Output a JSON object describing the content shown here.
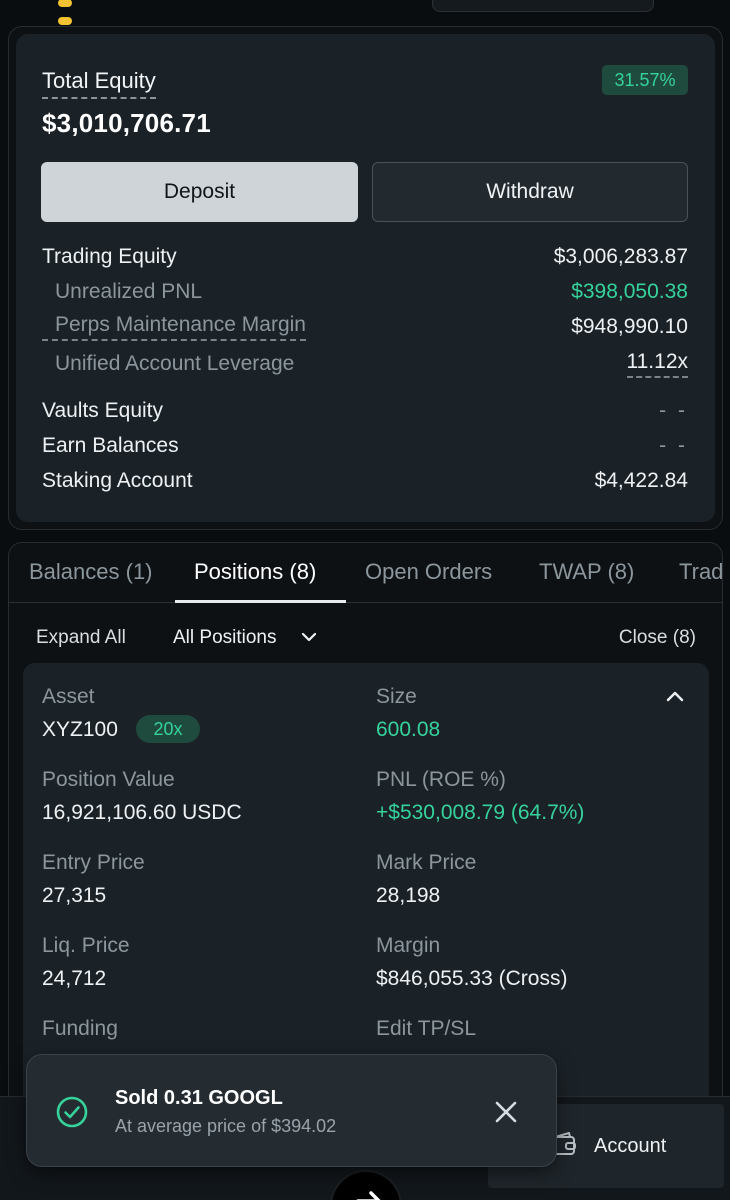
{
  "equity": {
    "total_label": "Total Equity",
    "total_value": "$3,010,706.71",
    "pct_change": "31.57%",
    "deposit_label": "Deposit",
    "withdraw_label": "Withdraw",
    "rows": [
      {
        "label": "Trading Equity",
        "value": "$3,006,283.87"
      },
      {
        "label": "Unrealized PNL",
        "value": "$398,050.38"
      },
      {
        "label": "Perps Maintenance Margin",
        "value": "$948,990.10"
      },
      {
        "label": "Unified Account Leverage",
        "value": "11.12x"
      },
      {
        "label": "Vaults Equity",
        "value": "- -"
      },
      {
        "label": "Earn Balances",
        "value": "- -"
      },
      {
        "label": "Staking Account",
        "value": "$4,422.84"
      }
    ]
  },
  "tabs": [
    "Balances (1)",
    "Positions (8)",
    "Open Orders",
    "TWAP (8)",
    "Trad"
  ],
  "filters": {
    "expand_all": "Expand All",
    "all_positions": "All Positions",
    "close_all": "Close (8)"
  },
  "position": {
    "asset_label": "Asset",
    "asset_value": "XYZ100",
    "leverage": "20x",
    "size_label": "Size",
    "size_value": "600.08",
    "position_value_label": "Position Value",
    "position_value": "16,921,106.60 USDC",
    "pnl_label": "PNL (ROE %)",
    "pnl_value": "+$530,008.79 (64.7%)",
    "entry_label": "Entry Price",
    "entry_value": "27,315",
    "mark_label": "Mark Price",
    "mark_value": "28,198",
    "liq_label": "Liq. Price",
    "liq_value": "24,712",
    "margin_label": "Margin",
    "margin_value": "$846,055.33 (Cross)",
    "funding_label": "Funding",
    "tpsl_label": "Edit TP/SL"
  },
  "toast": {
    "title": "Sold 0.31 GOOGL",
    "subtitle": "At average price of $394.02"
  },
  "nav": {
    "account_label": "Account"
  },
  "colors": {
    "accent_green": "#35d39b",
    "card_bg": "#1b2227",
    "page_bg": "#0a0d10"
  }
}
